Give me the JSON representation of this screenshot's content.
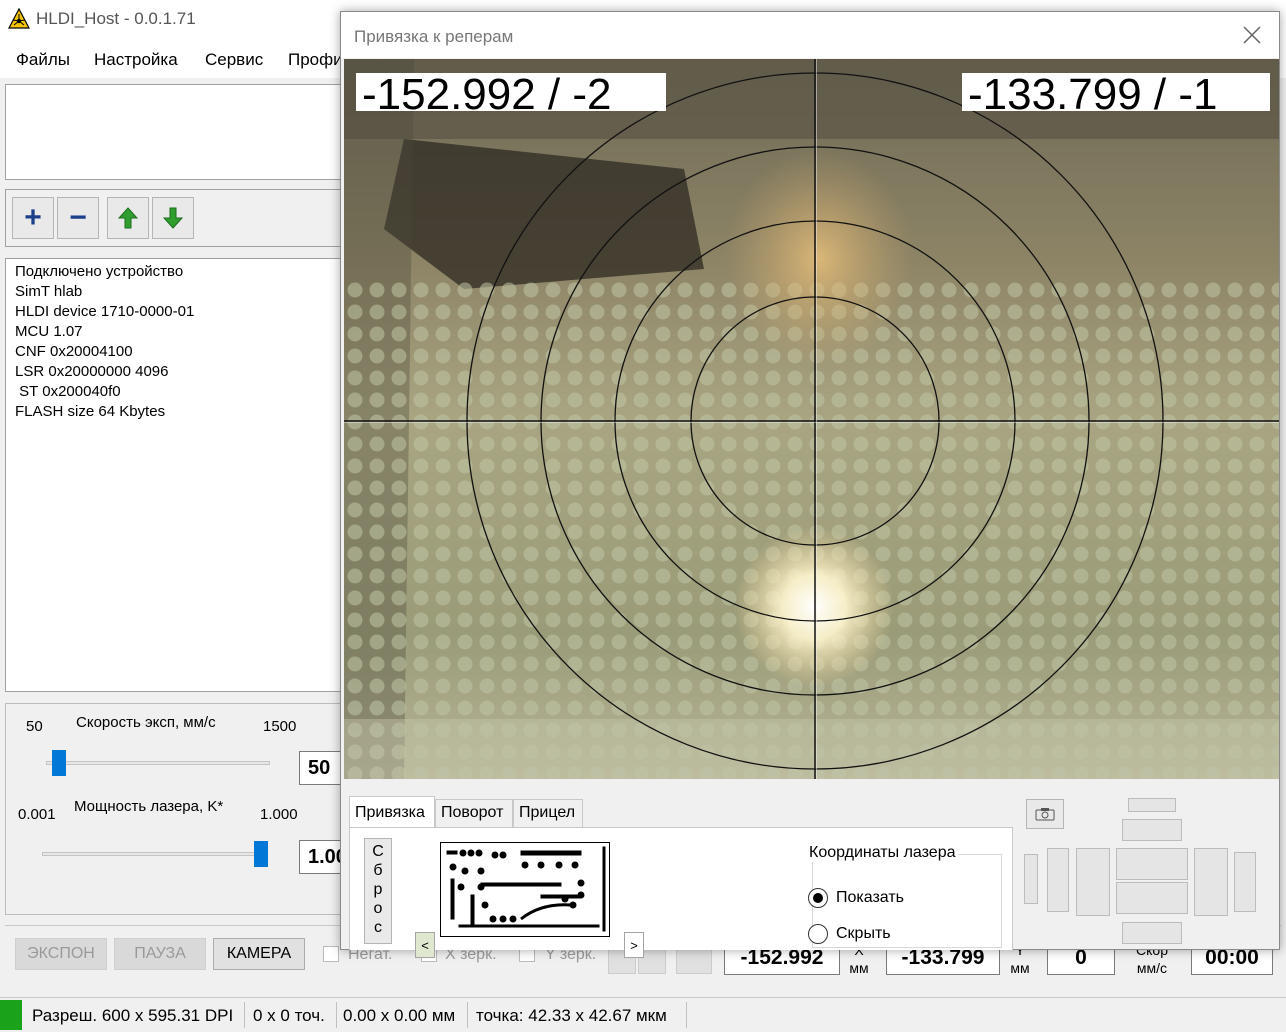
{
  "app": {
    "title": "HLDI_Host - 0.0.1.71"
  },
  "menu": [
    "Файлы",
    "Настройка",
    "Сервис",
    "Профи"
  ],
  "toolbar": {
    "add": "+",
    "remove": "−"
  },
  "log": [
    "Подключено устройство",
    "SimT hlab",
    "HLDI device 1710-0000-01",
    "MCU 1.07",
    "CNF 0x20004100",
    "LSR 0x20000000 4096",
    " ST 0x200040f0",
    "FLASH size 64 Kbytes"
  ],
  "speed": {
    "label": "Скорость эксп, мм/с",
    "min": "50",
    "max": "1500",
    "value": "50",
    "position": 0.0
  },
  "power": {
    "label": "Мощность лазера, K*",
    "min": "0.001",
    "max": "1.000",
    "value": "1.00",
    "position": 1.0
  },
  "buttons": {
    "expose": "ЭКСПОН",
    "pause": "ПАУЗА",
    "camera": "КАМЕРА"
  },
  "checks": {
    "negative": "Негат.",
    "x_mirror": "X зерк.",
    "y_mirror": "Y зерк."
  },
  "coords": {
    "x_value": "-152.992",
    "x_label": "X",
    "x_unit": "мм",
    "y_value": "-133.799",
    "y_label": "Y",
    "y_unit": "мм",
    "speed_value": "0",
    "speed_label": "Скор",
    "speed_unit": "мм/с",
    "time": "00:00"
  },
  "status": {
    "resolution": "Разреш. 600 x 595.31 DPI",
    "points": "0 x 0 точ.",
    "size": "0.00 x 0.00 мм",
    "dot": "точка: 42.33 x 42.67 мкм"
  },
  "dialog": {
    "title": "Привязка к реперам",
    "readout_left": "-152.992 / -2",
    "readout_right": "-133.799 / -1",
    "tabs": [
      "Привязка",
      "Поворот",
      "Прицел"
    ],
    "active_tab": 0,
    "reset_letters": [
      "С",
      "б",
      "р",
      "о",
      "с"
    ],
    "scroll_left": "<",
    "scroll_right": ">",
    "laser_group": "Координаты лазера",
    "show": "Показать",
    "hide": "Скрыть",
    "selected": "show"
  },
  "colors": {
    "accent": "#0078d7",
    "status_ok": "#1aa31a",
    "arrow_green": "#2f9e2f"
  }
}
